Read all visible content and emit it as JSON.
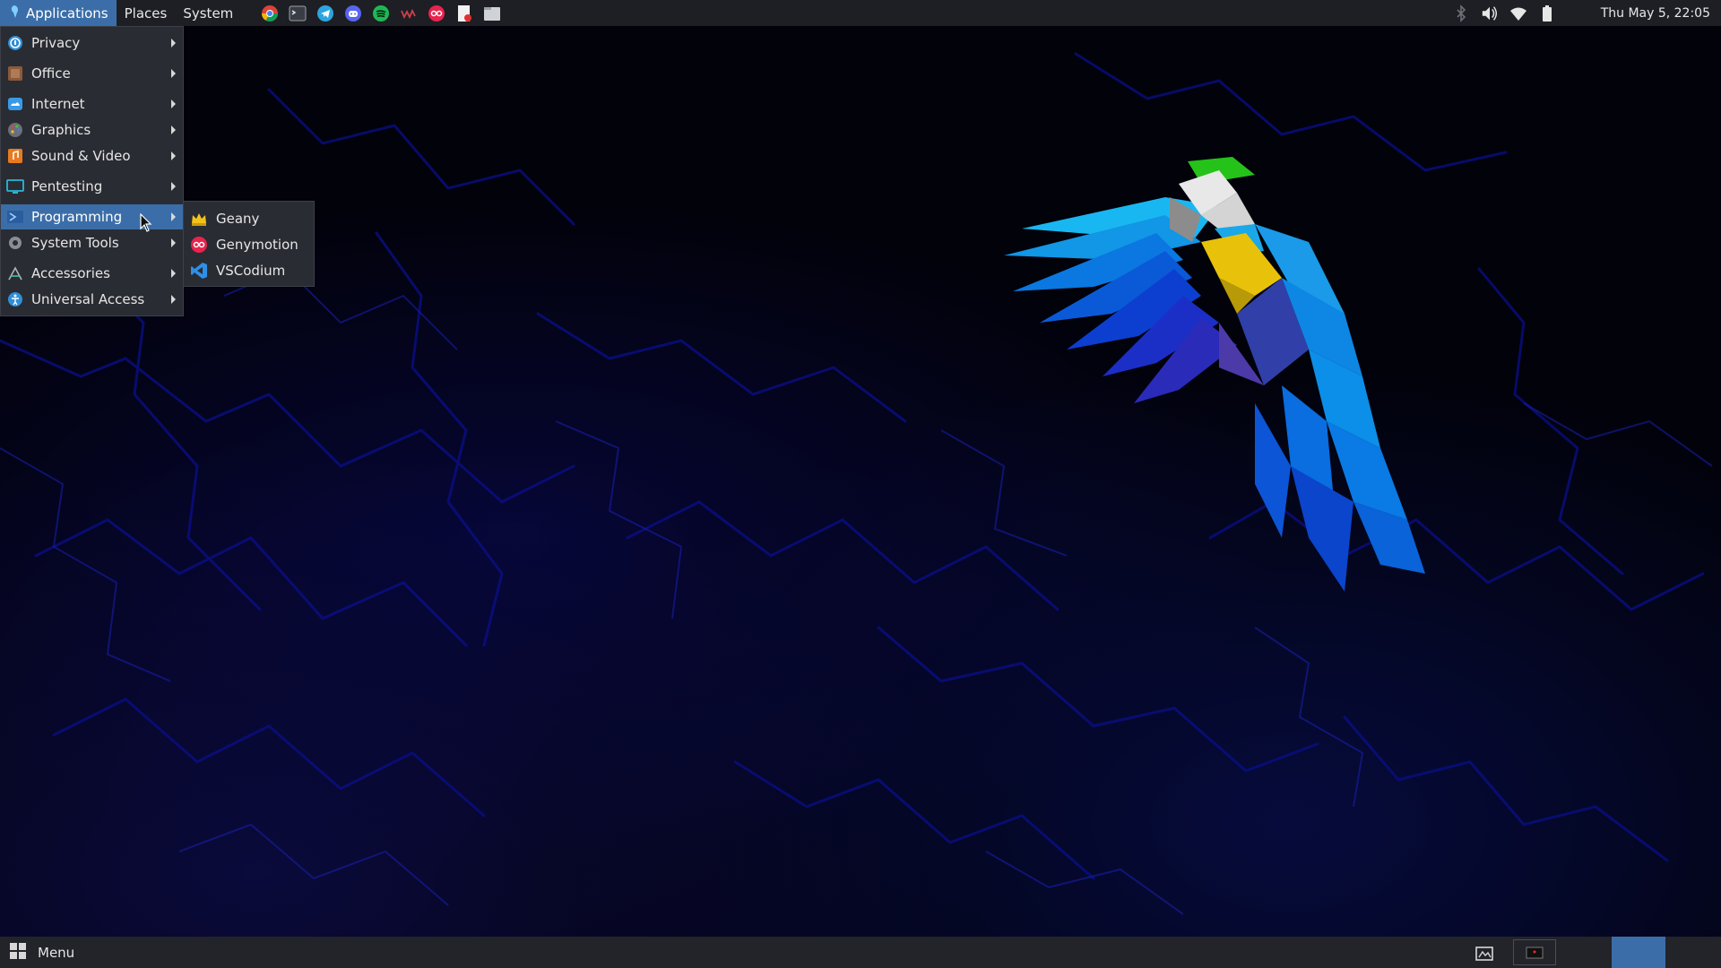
{
  "top_panel": {
    "menus": [
      {
        "label": "Applications",
        "active": true
      },
      {
        "label": "Places"
      },
      {
        "label": "System"
      }
    ],
    "launchers": [
      "chrome-icon",
      "terminal-icon",
      "telegram-icon",
      "discord-icon",
      "spotify-icon",
      "wm-app-icon",
      "genymotion-icon",
      "text-editor-icon",
      "file-manager-icon"
    ],
    "tray": [
      "bluetooth-icon",
      "volume-icon",
      "wifi-icon",
      "battery-icon"
    ],
    "clock": "Thu May  5, 22:05"
  },
  "app_menu": {
    "items": [
      {
        "label": "Privacy",
        "icon": "privacy-icon"
      },
      {
        "label": "Office",
        "icon": "office-icon"
      },
      {
        "label": "Internet",
        "icon": "internet-icon"
      },
      {
        "label": "Graphics",
        "icon": "graphics-icon"
      },
      {
        "label": "Sound & Video",
        "icon": "sound-video-icon"
      },
      {
        "label": "Pentesting",
        "icon": "pentesting-icon"
      },
      {
        "label": "Programming",
        "icon": "programming-icon",
        "active": true
      },
      {
        "label": "System Tools",
        "icon": "system-tools-icon"
      },
      {
        "label": "Accessories",
        "icon": "accessories-icon"
      },
      {
        "label": "Universal Access",
        "icon": "universal-access-icon"
      }
    ]
  },
  "sub_menu": {
    "items": [
      {
        "label": "Geany",
        "icon": "geany-icon"
      },
      {
        "label": "Genymotion",
        "icon": "genymotion-icon"
      },
      {
        "label": "VSCodium",
        "icon": "vscodium-icon"
      }
    ]
  },
  "bottom_panel": {
    "menu_label": "Menu"
  },
  "colors": {
    "accent": "#3b6ea8",
    "panel": "#1d1f25",
    "menu_bg": "#2a2c33"
  }
}
